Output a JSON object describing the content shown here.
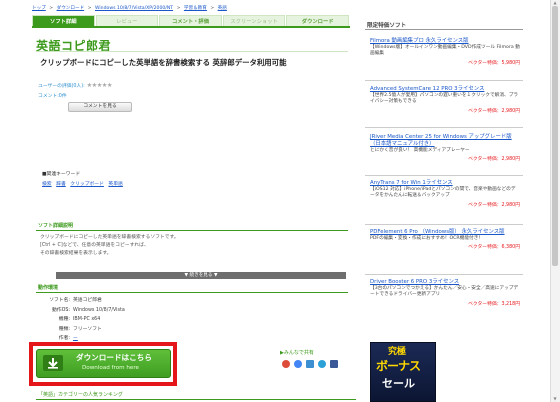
{
  "breadcrumb": [
    "トップ",
    ">",
    "ダウンロード",
    ">",
    "Windows 10/8/7/Vista/XP/2000/NT",
    ">",
    "学習＆教育",
    ">",
    "英語"
  ],
  "tabs": [
    {
      "label": "ソフト詳細"
    },
    {
      "label": "レビュー"
    },
    {
      "label": "コメント・評価"
    },
    {
      "label": "スクリーンショット"
    },
    {
      "label": "ダウンロード"
    }
  ],
  "software": {
    "title": "英語コピ郎君",
    "subtitle": "クリップボードにコピーした英単語を辞書検索する 英辞郎データ利用可能"
  },
  "rating": {
    "user_label": "ユーザーの評価(0人):",
    "stars": "★★★★★",
    "comment_label": "コメント:0件",
    "comment_button": "コメントを見る"
  },
  "keywords": {
    "header": "■関連キーワード",
    "items": [
      "検索",
      "辞書",
      "クリップボード",
      "英単語"
    ]
  },
  "description": {
    "header": "ソフト詳細説明",
    "lines": [
      "クリップボードにコピーした英単語を辞書検索するソフトです。",
      "[Ctrl + C]などで、任意の英単語をコピーすれば、",
      "その辞書検索結果を表示します。"
    ],
    "more_button": "▼ 続きを見る ▼"
  },
  "environment": {
    "header": "動作環境",
    "rows": [
      {
        "k": "ソフト名:",
        "v": "英語コピ郎君"
      },
      {
        "k": "動作OS:",
        "v": "Windows 10/8/7/Vista"
      },
      {
        "k": "機種:",
        "v": "IBM-PC x64"
      },
      {
        "k": "種類:",
        "v": "フリーソフト"
      },
      {
        "k": "作者:",
        "v": "ー"
      }
    ]
  },
  "download": {
    "icon": "download-arrow-icon",
    "main_label": "ダウンロードはこちら",
    "sub_label": "Download from here"
  },
  "share": {
    "label": "▶みんなで共有",
    "icons": [
      {
        "name": "google-icon",
        "color": "#dd4b39"
      },
      {
        "name": "google-plus-icon",
        "color": "#4285f4"
      },
      {
        "name": "mixi-icon",
        "color": "#3c8fd1"
      },
      {
        "name": "twitter-icon",
        "color": "#2ba1d8"
      },
      {
        "name": "facebook-icon",
        "color": "#3b5998"
      }
    ]
  },
  "ranking": {
    "header": "「英語」カテゴリーの人気ランキング"
  },
  "sidebar": {
    "header": "限定特価ソフト",
    "promos": [
      {
        "title": "Filmora 動画編集プロ 永久ライセンス版",
        "desc": "【Windows版】オールインワン動画編集・DVD作成ツール Filmora 動画編集",
        "price": "ベクター特価：5,980円"
      },
      {
        "title": "Advanced SystemCare 12 PRO 3ライセンス",
        "desc": "【世界2.5億人が愛用】パソコンの遅い重いを１クリックで解消、プライバシー対策もできる",
        "price": "ベクター特価：2,980円"
      },
      {
        "title": "JRiver Media Center 25 for Windows アップグレード版（日本語マニュアル付き）",
        "desc": "とにかく音が良い！ 高機能メディアプレーヤー",
        "price": "ベクター特価：2,980円"
      },
      {
        "title": "AnyTrans 7 for Win 1ライセンス",
        "desc": "【iOS12 対応】iPhone/iPadとパソコンの間で、音楽や動画などのデータをかんたんに転送＆バックアップ",
        "price": "ベクター特価：2,980円"
      },
      {
        "title": "PDFelement 6 Pro （Windows版） 永久ライセンス版",
        "desc": "PDFの編集・変換・作成におすすめ！OCR機能付き！",
        "price": "ベクター特価：6,380円"
      },
      {
        "title": "Driver Booster 6 PRO 3ライセンス",
        "desc": "【3台のパソコンでつかえる】かんたん／安心・安全／高速にアップデートできるドライバー更新アプリ",
        "price": "ベクター特価：3,218円"
      }
    ]
  },
  "ad": {
    "line1": "究極",
    "line2": "ボーナス",
    "line3": "セール"
  },
  "colors": {
    "accent_green": "#3c9a1c",
    "link_blue": "#1a57c9",
    "price_red": "#e5161a",
    "highlight_frame": "#e5161a"
  }
}
